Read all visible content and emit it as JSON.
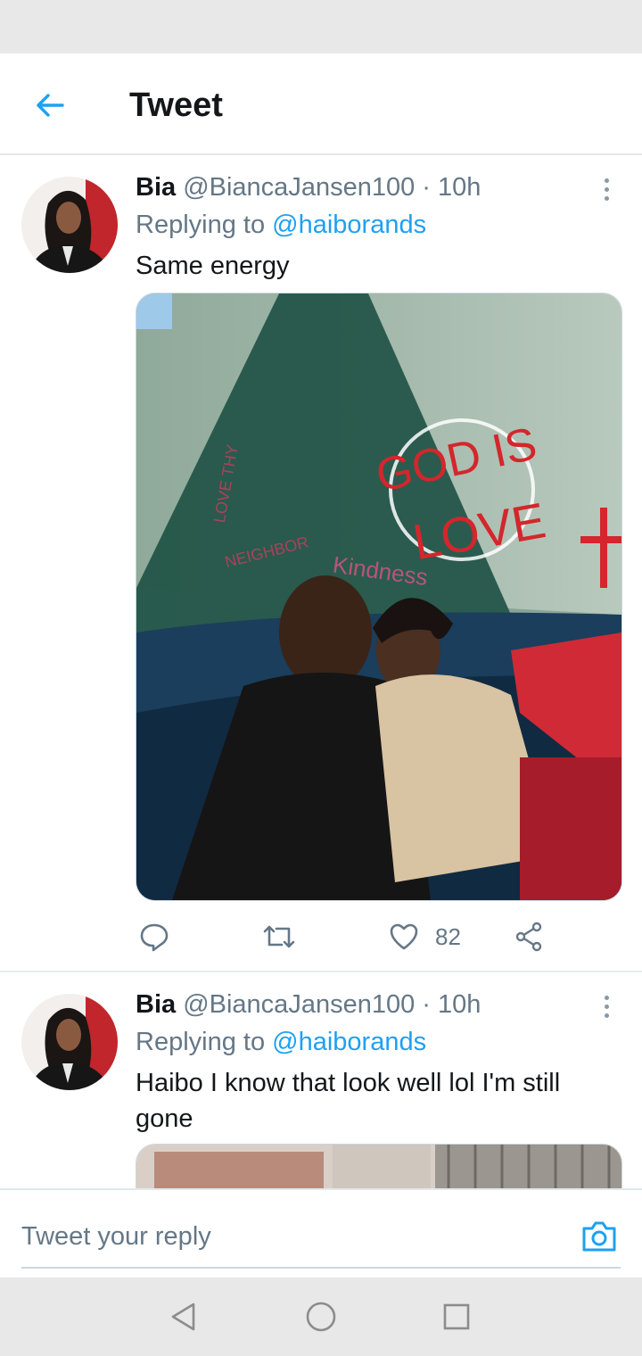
{
  "header": {
    "title": "Tweet"
  },
  "tweets": [
    {
      "name": "Bia",
      "handle": "@BiancaJansen100",
      "separator": "·",
      "time": "10h",
      "replying_prefix": "Replying to",
      "replying_to": "@haiborands",
      "text": "Same energy",
      "media_wall_text": [
        "GOD IS",
        "LOVE",
        "LOVE THY",
        "NEIGHBOR",
        "Kindness"
      ],
      "actions": {
        "reply_icon": "reply-icon",
        "retweet_icon": "retweet-icon",
        "like_icon": "heart-icon",
        "like_count": "82",
        "share_icon": "share-icon"
      }
    },
    {
      "name": "Bia",
      "handle": "@BiancaJansen100",
      "separator": "·",
      "time": "10h",
      "replying_prefix": "Replying to",
      "replying_to": "@haiborands",
      "text": "Haibo I know that look well lol I'm still gone"
    }
  ],
  "reply_bar": {
    "placeholder": "Tweet your reply",
    "camera_icon": "camera-icon"
  },
  "nav": {
    "back_icon": "triangle-back-icon",
    "home_icon": "circle-home-icon",
    "recents_icon": "square-recents-icon"
  },
  "colors": {
    "accent": "#1da1f2",
    "text": "#14171a",
    "muted": "#657786",
    "divider": "#e6ecf0"
  }
}
